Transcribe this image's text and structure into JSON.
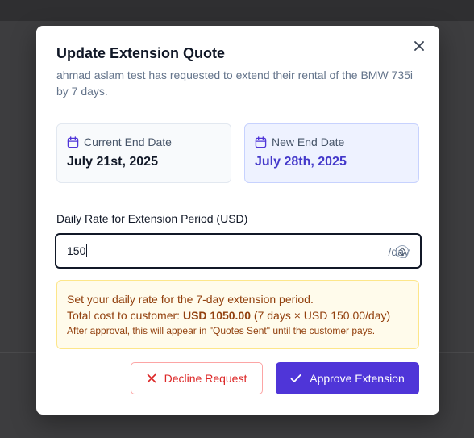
{
  "modal": {
    "title": "Update Extension Quote",
    "subtitle": "ahmad aslam test has requested to extend their rental of the BMW 735i by 7 days."
  },
  "current_end": {
    "label": "Current End Date",
    "value": "July 21st, 2025",
    "icon": "calendar-icon"
  },
  "new_end": {
    "label": "New End Date",
    "value": "July 28th, 2025",
    "icon": "calendar-icon"
  },
  "rate": {
    "label": "Daily Rate for Extension Period (USD)",
    "value": "150",
    "suffix": "/day"
  },
  "info": {
    "line1": "Set your daily rate for the 7-day extension period.",
    "total_prefix": "Total cost to customer: ",
    "total_amount": "USD 1050.00",
    "total_suffix": " (7 days × USD 150.00/day)",
    "note": "After approval, this will appear in \"Quotes Sent\" until the customer pays."
  },
  "buttons": {
    "decline": "Decline Request",
    "approve": "Approve Extension"
  },
  "colors": {
    "accent": "#4f35d8",
    "danger": "#dc2626",
    "warning_text": "#92400e"
  }
}
